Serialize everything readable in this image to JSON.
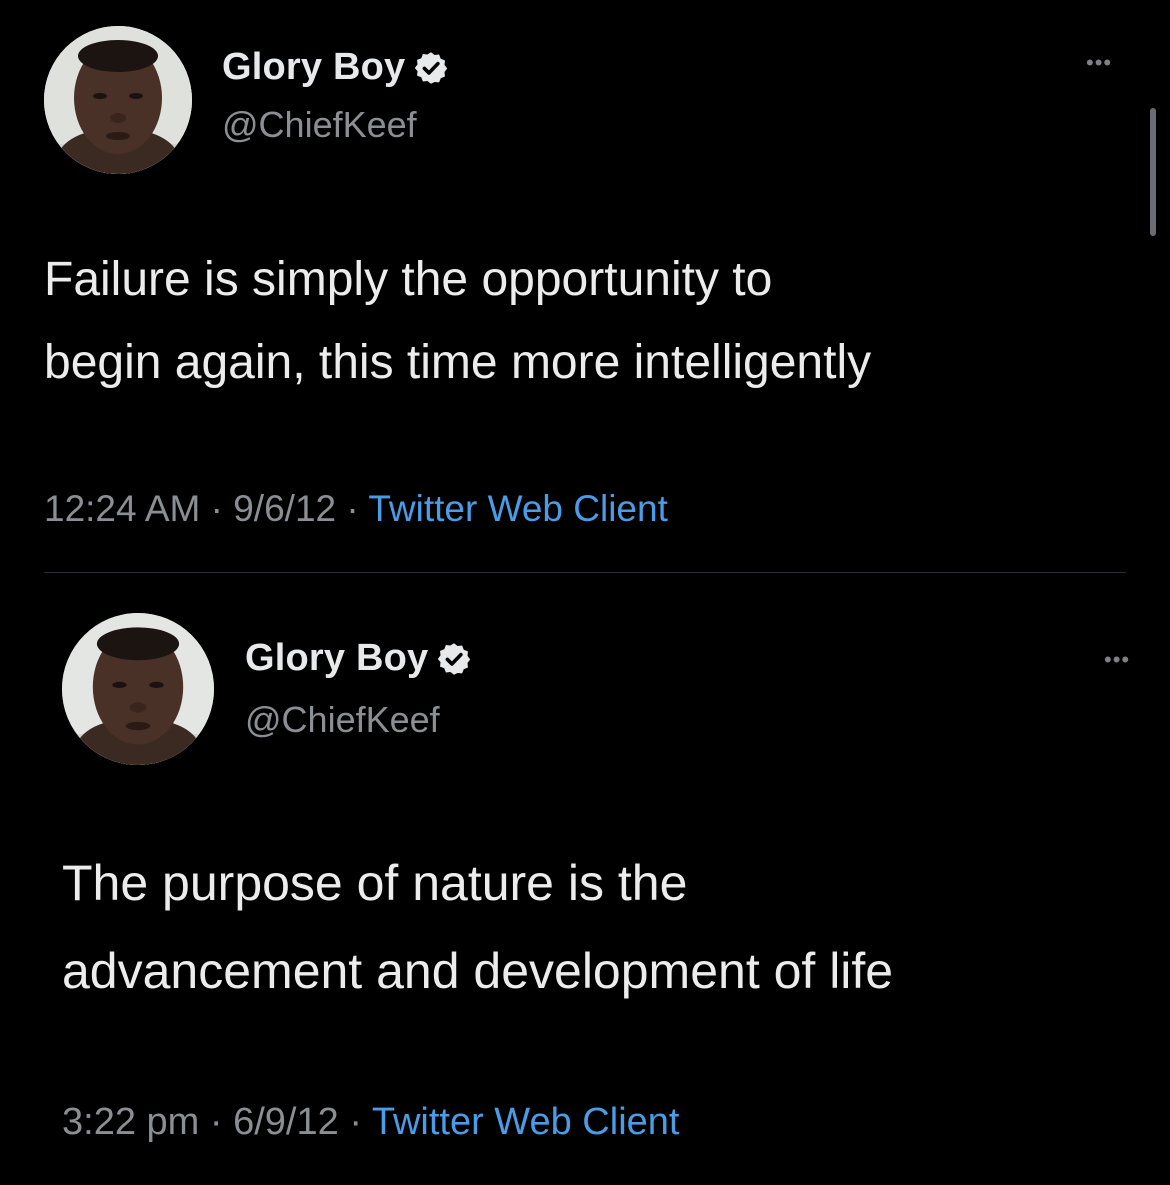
{
  "tweets": [
    {
      "display_name": "Glory Boy",
      "handle": "@ChiefKeef",
      "verified_icon": "verified-badge-icon",
      "more_icon": "more-options-icon",
      "more_glyph": "•••",
      "text_lines": [
        "Failure is simply the opportunity to",
        "begin again, this time more intelligently"
      ],
      "time": "12:24 AM",
      "separator": "·",
      "date": "9/6/12",
      "client": "Twitter Web Client"
    },
    {
      "display_name": "Glory Boy",
      "handle": "@ChiefKeef",
      "verified_icon": "verified-badge-icon",
      "more_icon": "more-options-icon",
      "more_glyph": "•••",
      "text_lines": [
        "The purpose of nature is the",
        "advancement and development of life"
      ],
      "time": "3:22 pm",
      "separator": "·",
      "date": "6/9/12",
      "client": "Twitter Web Client"
    }
  ],
  "colors": {
    "background": "#000000",
    "primary_text": "#e7e9ea",
    "secondary_text": "#8b8f94",
    "link": "#4a9ce6"
  }
}
